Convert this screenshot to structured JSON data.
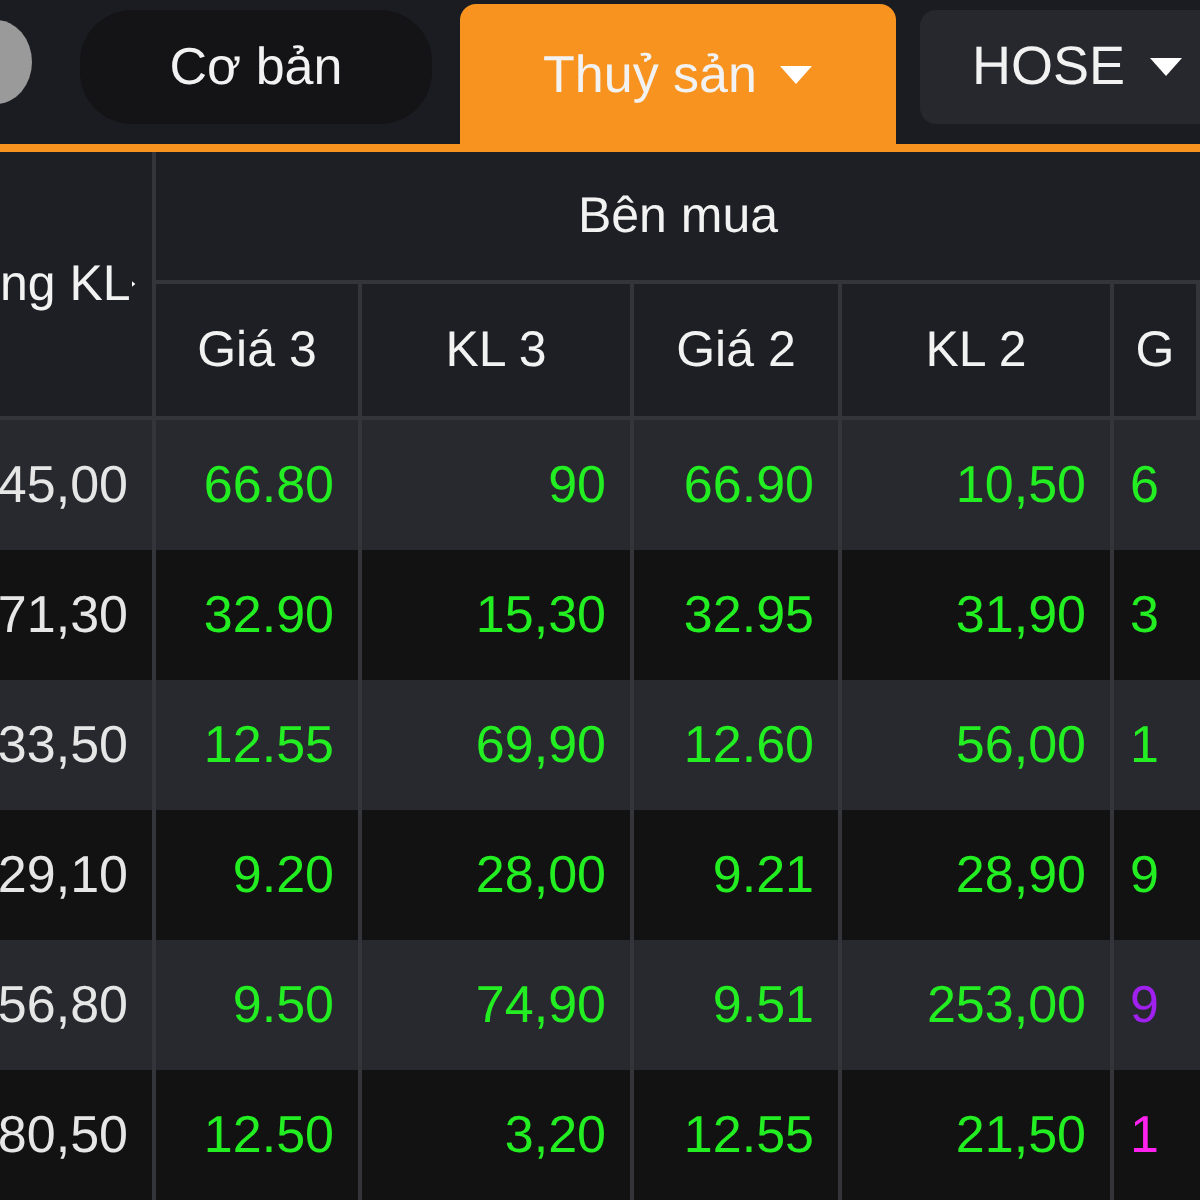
{
  "tabs": [
    {
      "label": "Cơ bản",
      "kind": "tab",
      "selected": false,
      "dropdown": false
    },
    {
      "label": "Thuỷ sản",
      "kind": "tab",
      "selected": true,
      "dropdown": true
    },
    {
      "label": "HOSE",
      "kind": "select",
      "selected": false,
      "dropdown": true
    }
  ],
  "table": {
    "group_header": "Bên mua",
    "columns": [
      "ng KL",
      "Giá 3",
      "KL 3",
      "Giá 2",
      "KL 2",
      "G"
    ],
    "rows": [
      {
        "cells": [
          {
            "text": "45,00",
            "color": "#e6e6e6"
          },
          {
            "text": "66.80",
            "color": "#22ee22"
          },
          {
            "text": "90",
            "color": "#22ee22"
          },
          {
            "text": "66.90",
            "color": "#22ee22"
          },
          {
            "text": "10,50",
            "color": "#22ee22"
          },
          {
            "text": "6",
            "color": "#22ee22"
          }
        ]
      },
      {
        "cells": [
          {
            "text": "71,30",
            "color": "#e6e6e6"
          },
          {
            "text": "32.90",
            "color": "#22ee22"
          },
          {
            "text": "15,30",
            "color": "#22ee22"
          },
          {
            "text": "32.95",
            "color": "#22ee22"
          },
          {
            "text": "31,90",
            "color": "#22ee22"
          },
          {
            "text": "3",
            "color": "#22ee22"
          }
        ]
      },
      {
        "cells": [
          {
            "text": "33,50",
            "color": "#e6e6e6"
          },
          {
            "text": "12.55",
            "color": "#22ee22"
          },
          {
            "text": "69,90",
            "color": "#22ee22"
          },
          {
            "text": "12.60",
            "color": "#22ee22"
          },
          {
            "text": "56,00",
            "color": "#22ee22"
          },
          {
            "text": "1",
            "color": "#22ee22"
          }
        ]
      },
      {
        "cells": [
          {
            "text": "29,10",
            "color": "#e6e6e6"
          },
          {
            "text": "9.20",
            "color": "#22ee22"
          },
          {
            "text": "28,00",
            "color": "#22ee22"
          },
          {
            "text": "9.21",
            "color": "#22ee22"
          },
          {
            "text": "28,90",
            "color": "#22ee22"
          },
          {
            "text": "9",
            "color": "#22ee22"
          }
        ]
      },
      {
        "cells": [
          {
            "text": "56,80",
            "color": "#e6e6e6"
          },
          {
            "text": "9.50",
            "color": "#22ee22"
          },
          {
            "text": "74,90",
            "color": "#22ee22"
          },
          {
            "text": "9.51",
            "color": "#22ee22"
          },
          {
            "text": "253,00",
            "color": "#22ee22"
          },
          {
            "text": "9",
            "color": "#a020f0"
          }
        ]
      },
      {
        "cells": [
          {
            "text": "80,50",
            "color": "#e6e6e6"
          },
          {
            "text": "12.50",
            "color": "#22ee22"
          },
          {
            "text": "3,20",
            "color": "#22ee22"
          },
          {
            "text": "12.55",
            "color": "#22ee22"
          },
          {
            "text": "21,50",
            "color": "#22ee22"
          },
          {
            "text": "1",
            "color": "#ff22ee"
          }
        ]
      }
    ]
  }
}
